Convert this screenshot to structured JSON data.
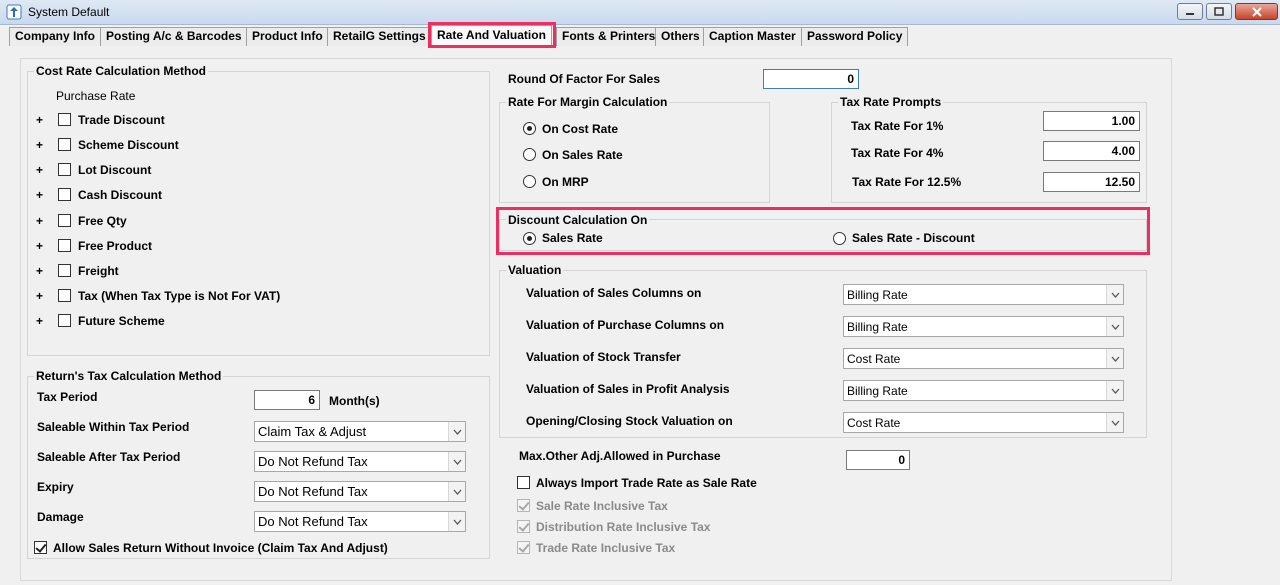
{
  "window": {
    "title": "System Default"
  },
  "tabs": [
    {
      "label": "Company Info"
    },
    {
      "label": "Posting A/c & Barcodes"
    },
    {
      "label": "Product Info"
    },
    {
      "label": "RetailG Settings"
    },
    {
      "label": "Rate And Valuation"
    },
    {
      "label": "Fonts & Printers"
    },
    {
      "label": "Others"
    },
    {
      "label": "Caption Master"
    },
    {
      "label": "Password Policy"
    }
  ],
  "active_tab": "Rate And Valuation",
  "highlight_color": "#ea2f62",
  "cost_rate": {
    "title": "Cost Rate Calculation Method",
    "purchase_rate_label": "Purchase Rate",
    "expand_symbol": "+",
    "items": [
      {
        "label": "Trade Discount",
        "checked": false
      },
      {
        "label": "Scheme  Discount",
        "checked": false
      },
      {
        "label": "Lot Discount",
        "checked": false
      },
      {
        "label": "Cash Discount",
        "checked": false
      },
      {
        "label": "Free Qty",
        "checked": false
      },
      {
        "label": "Free Product",
        "checked": false
      },
      {
        "label": "Freight",
        "checked": false
      },
      {
        "label": "Tax (When Tax Type is Not For VAT)",
        "checked": false
      },
      {
        "label": "Future Scheme",
        "checked": false
      }
    ]
  },
  "return_tax": {
    "title": "Return's Tax Calculation Method",
    "tax_period_label": "Tax Period",
    "tax_period_value": "6",
    "tax_period_unit": "Month(s)",
    "rows": [
      {
        "label": "Saleable  Within Tax Period",
        "value": "Claim Tax & Adjust"
      },
      {
        "label": "Saleable  After Tax Period",
        "value": "Do Not Refund Tax"
      },
      {
        "label": "Expiry",
        "value": "Do Not Refund Tax"
      },
      {
        "label": "Damage",
        "value": "Do Not Refund Tax"
      }
    ],
    "allow_return_label": "Allow Sales Return Without Invoice (Claim Tax And Adjust)",
    "allow_return_checked": true
  },
  "round_factor": {
    "label": "Round Of Factor For Sales",
    "value": "0"
  },
  "margin_calc": {
    "title": "Rate For Margin Calculation",
    "options": [
      {
        "label": "On Cost Rate",
        "selected": true
      },
      {
        "label": "On Sales Rate",
        "selected": false
      },
      {
        "label": "On MRP",
        "selected": false
      }
    ]
  },
  "tax_prompts": {
    "title": "Tax Rate Prompts",
    "rows": [
      {
        "label": "Tax Rate For 1%",
        "value": "1.00"
      },
      {
        "label": "Tax Rate For 4%",
        "value": "4.00"
      },
      {
        "label": "Tax Rate For 12.5%",
        "value": "12.50"
      }
    ]
  },
  "discount_calc": {
    "title": "Discount Calculation On",
    "options": [
      {
        "label": "Sales Rate",
        "selected": true
      },
      {
        "label": "Sales Rate - Discount",
        "selected": false
      }
    ]
  },
  "valuation": {
    "title": "Valuation",
    "rows": [
      {
        "label": "Valuation of Sales Columns on",
        "value": "Billing Rate"
      },
      {
        "label": "Valuation of Purchase Columns on",
        "value": "Billing Rate"
      },
      {
        "label": "Valuation of Stock Transfer",
        "value": "Cost Rate"
      },
      {
        "label": "Valuation of Sales in Profit Analysis",
        "value": "Billing Rate"
      },
      {
        "label": "Opening/Closing Stock Valuation on",
        "value": "Cost Rate"
      }
    ]
  },
  "max_adj": {
    "label": "Max.Other Adj.Allowed in Purchase",
    "value": "0"
  },
  "options": [
    {
      "label": "Always Import Trade Rate as Sale Rate",
      "checked": false,
      "disabled": false
    },
    {
      "label": "Sale Rate Inclusive Tax",
      "checked": true,
      "disabled": true
    },
    {
      "label": "Distribution Rate Inclusive Tax",
      "checked": true,
      "disabled": true
    },
    {
      "label": "Trade Rate Inclusive Tax",
      "checked": true,
      "disabled": true
    }
  ]
}
